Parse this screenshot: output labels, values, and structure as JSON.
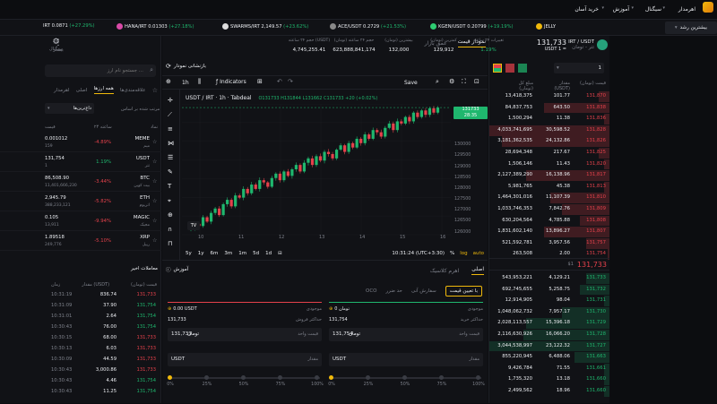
{
  "colors": {
    "buy": "#1fb76e",
    "sell": "#e5414b",
    "accent": "#f0b90b"
  },
  "topbar": {
    "quick_buy": "خرید آسان",
    "learn": "آموزش",
    "signal": "سیگنال",
    "exchange": "اهرمدار",
    "growth": "بیشترین رشد"
  },
  "ticker": [
    {
      "sym": "IRT",
      "price": "0.0871",
      "chg": "(+27.29%)",
      "pos": true
    },
    {
      "sym": "HANA/IRT",
      "price": "0.01303",
      "chg": "(+27.18%)",
      "pos": true
    },
    {
      "sym": "SWARMS/IRT",
      "price": "2,149.57",
      "chg": "(+23.62%)",
      "pos": true
    },
    {
      "sym": "ACE/USDT",
      "price": "0.2729",
      "chg": "(+21.53%)",
      "pos": true
    },
    {
      "sym": "KGEN/USDT",
      "price": "0.20799",
      "chg": "(+19.19%)",
      "pos": true
    },
    {
      "sym": "JELLY",
      "price": "",
      "chg": "",
      "pos": true
    }
  ],
  "header": {
    "pair": "IRT / USDT",
    "pair_sub": "تتر - تومان",
    "price": "131,733",
    "price_sub": "USDT 1 =",
    "stats": [
      {
        "label": "تغییرات ۲۴ ساعته",
        "value": "1.19%",
        "pos": true
      },
      {
        "label": "کمترین (تومان)",
        "value": "129,912"
      },
      {
        "label": "بیشترین (تومان)",
        "value": "132,000"
      },
      {
        "label": "حجم ۲۴ ساعته (تومان)",
        "value": "623,888,841,174"
      },
      {
        "label": "حجم ۲۴ ساعته (USDT)",
        "value": "4,745,255.41"
      }
    ],
    "signal": "سیگنال",
    "fav": "بیشتر"
  },
  "market": {
    "search_placeholder": "جستجو نام ارز ...",
    "tabs": [
      "علاقه‌مندی‌ها",
      "همه ارزها",
      "اصلی",
      "اهرمدار"
    ],
    "sort_label": "مرتب شده بر اساس",
    "sort_value": "داغ‌ترین‌ها",
    "cols": [
      "نماد",
      "۲۴ ساعته",
      "قیمت"
    ],
    "rows": [
      {
        "sym": "MEME",
        "name": "میم",
        "chg": "-4.89%",
        "price": "0.001012",
        "price_sub": "159",
        "pos": false
      },
      {
        "sym": "USDT",
        "name": "تتر",
        "chg": "1.19%",
        "price": "131,754",
        "price_sub": "1",
        "pos": true
      },
      {
        "sym": "BTC",
        "name": "بیت کوین",
        "chg": "-3.44%",
        "price": "86,508.90",
        "price_sub": "11,401,666,230",
        "pos": false
      },
      {
        "sym": "ETH",
        "name": "اتریوم",
        "chg": "-5.82%",
        "price": "2,945.79",
        "price_sub": "388,233,121",
        "pos": false
      },
      {
        "sym": "MAGIC",
        "name": "مجیک",
        "chg": "-9.94%",
        "price": "0.105",
        "price_sub": "13,911",
        "pos": false
      },
      {
        "sym": "XRP",
        "name": "ریپل",
        "chg": "-5.10%",
        "price": "1.89518",
        "price_sub": "249,776",
        "pos": false
      }
    ],
    "recent_title": "معاملات اخیر",
    "recent_cols": [
      "قیمت (تومان)",
      "مقدار (USDT)",
      "زمان"
    ],
    "recent": [
      {
        "p": "131,733",
        "q": "836.74",
        "t": "10:31:19",
        "pos": false
      },
      {
        "p": "131,754",
        "q": "37.90",
        "t": "10:31:09",
        "pos": true
      },
      {
        "p": "131,754",
        "q": "2.64",
        "t": "10:31:01",
        "pos": true
      },
      {
        "p": "131,754",
        "q": "76.00",
        "t": "10:30:43",
        "pos": true
      },
      {
        "p": "131,733",
        "q": "68.00",
        "t": "10:30:15",
        "pos": false
      },
      {
        "p": "131,733",
        "q": "6.03",
        "t": "10:30:13",
        "pos": false
      },
      {
        "p": "131,733",
        "q": "44.59",
        "t": "10:30:09",
        "pos": false
      },
      {
        "p": "131,733",
        "q": "3,000.86",
        "t": "10:30:43",
        "pos": false
      },
      {
        "p": "131,754",
        "q": "4.46",
        "t": "10:30:43",
        "pos": true
      },
      {
        "p": "131,754",
        "q": "11.25",
        "t": "10:30:43",
        "pos": true
      }
    ]
  },
  "chart": {
    "tabs": [
      "نمودار قیمت",
      "عمق بازار"
    ],
    "tv_label": "بازنشانی نمودار",
    "interval": "1h",
    "indicators": "Indicators",
    "save": "Save",
    "legend": "USDT / IRT · 1h · Tabdeal",
    "ohlc": "O131733 H131844 L131662 C131733 +20 (+0.02%)",
    "price_tag": "131733",
    "price_tag_sub": "28:35",
    "ranges": [
      "5y",
      "1y",
      "6m",
      "3m",
      "1m",
      "5d",
      "1d"
    ],
    "clock": "10:31:24 (UTC+3:30)",
    "pct": "%",
    "log": "log",
    "auto": "auto",
    "x_ticks": [
      "10",
      "11",
      "12",
      "13",
      "14",
      "15",
      "16"
    ],
    "y_ticks": [
      "130000",
      "129500",
      "129000",
      "128500",
      "128000",
      "127500",
      "127000",
      "126500",
      "126000"
    ]
  },
  "chart_data": {
    "type": "candlestick",
    "interval": "1h",
    "y_range": [
      125900,
      131900
    ],
    "closes": [
      126200,
      126400,
      126300,
      126700,
      126500,
      126900,
      127100,
      126800,
      127300,
      127500,
      127200,
      127700,
      127600,
      128000,
      127800,
      128200,
      128000,
      128400,
      128300,
      128100,
      128500,
      128700,
      128400,
      128800,
      128600,
      128900,
      129100,
      128800,
      129200,
      129400,
      129100,
      129500,
      129300,
      129700,
      129600,
      129400,
      129800,
      130000,
      129700,
      130100,
      129900,
      130300,
      130100,
      130500,
      130300,
      130700,
      130600,
      130400,
      130800,
      131000,
      130700,
      131100,
      131000,
      131300,
      131100,
      131500,
      131300,
      131600,
      131400,
      131700,
      131500,
      131733
    ]
  },
  "orderbook": {
    "cols": [
      "قیمت (تومان)",
      "مقدار (USDT)",
      "مبلغ کل (تومان)"
    ],
    "asks": [
      {
        "p": "131,870",
        "q": "101.77",
        "t": "13,418,375",
        "d": 0.1
      },
      {
        "p": "131,838",
        "q": "643.50",
        "t": "84,837,753",
        "d": 0.55
      },
      {
        "p": "131,836",
        "q": "11.38",
        "t": "1,500,294",
        "d": 0.05
      },
      {
        "p": "131,828",
        "q": "30,598.52",
        "t": "4,033,741,695",
        "d": 1.0
      },
      {
        "p": "131,826",
        "q": "24,132.86",
        "t": "3,181,362,535",
        "d": 0.9
      },
      {
        "p": "131,825",
        "q": "217.67",
        "t": "28,694,348",
        "d": 0.1
      },
      {
        "p": "131,820",
        "q": "11.43",
        "t": "1,506,146",
        "d": 0.05
      },
      {
        "p": "131,817",
        "q": "16,138.96",
        "t": "2,127,389,290",
        "d": 0.7
      },
      {
        "p": "131,813",
        "q": "45.38",
        "t": "5,981,765",
        "d": 0.05
      },
      {
        "p": "131,810",
        "q": "11,107.39",
        "t": "1,464,301,016",
        "d": 0.5
      },
      {
        "p": "131,809",
        "q": "7,842.76",
        "t": "1,033,746,353",
        "d": 0.4
      },
      {
        "p": "131,808",
        "q": "4,785.88",
        "t": "630,204,564",
        "d": 0.25
      },
      {
        "p": "131,807",
        "q": "13,896.27",
        "t": "1,831,602,140",
        "d": 0.55
      },
      {
        "p": "131,757",
        "q": "3,957.56",
        "t": "521,592,781",
        "d": 0.2
      },
      {
        "p": "131,754",
        "q": "2.00",
        "t": "263,508",
        "d": 0.02
      }
    ],
    "spread_price": "131,733",
    "spread_sub": "$1",
    "bids": [
      {
        "p": "131,733",
        "q": "4,129.21",
        "t": "543,953,221",
        "d": 0.2
      },
      {
        "p": "131,732",
        "q": "5,258.75",
        "t": "692,745,655",
        "d": 0.25
      },
      {
        "p": "131,731",
        "q": "98.04",
        "t": "12,914,905",
        "d": 0.05
      },
      {
        "p": "131,730",
        "q": "7,957.17",
        "t": "1,048,062,732",
        "d": 0.4
      },
      {
        "p": "131,729",
        "q": "15,396.18",
        "t": "2,028,113,557",
        "d": 0.7
      },
      {
        "p": "131,728",
        "q": "16,066.20",
        "t": "2,116,630,926",
        "d": 0.72
      },
      {
        "p": "131,727",
        "q": "23,122.32",
        "t": "3,044,538,997",
        "d": 1.0
      },
      {
        "p": "131,663",
        "q": "6,488.06",
        "t": "855,220,945",
        "d": 0.3
      },
      {
        "p": "131,661",
        "q": "71.55",
        "t": "9,426,784",
        "d": 0.05
      },
      {
        "p": "131,660",
        "q": "13.18",
        "t": "1,735,320",
        "d": 0.05
      },
      {
        "p": "131,660",
        "q": "18.96",
        "t": "2,499,562",
        "d": 0.05
      }
    ],
    "qty_default": "1"
  },
  "order": {
    "tabs": [
      "اصلی",
      "اهرم کلاسیک"
    ],
    "learn": "آموزش",
    "types": [
      "با تعیین قیمت",
      "سفارش آنی",
      "حد ضرر",
      "OCO"
    ],
    "buy": {
      "balance_label": "موجودی",
      "balance": "0 تومان",
      "max_label": "حداکثر خرید",
      "max": "131,754",
      "price_label": "قیمت واحد",
      "price": "131,754",
      "price_unit": "تومان",
      "amount_label": "مقدار",
      "amount_unit": "USDT"
    },
    "sell": {
      "balance_label": "موجودی",
      "balance": "0.00 USDT",
      "max_label": "حداکثر فروش",
      "max": "131,733",
      "price_label": "قیمت واحد",
      "price": "131,733",
      "price_unit": "تومان",
      "amount_label": "مقدار",
      "amount_unit": "USDT"
    },
    "steps": [
      "0%",
      "25%",
      "50%",
      "75%",
      "100%"
    ]
  }
}
